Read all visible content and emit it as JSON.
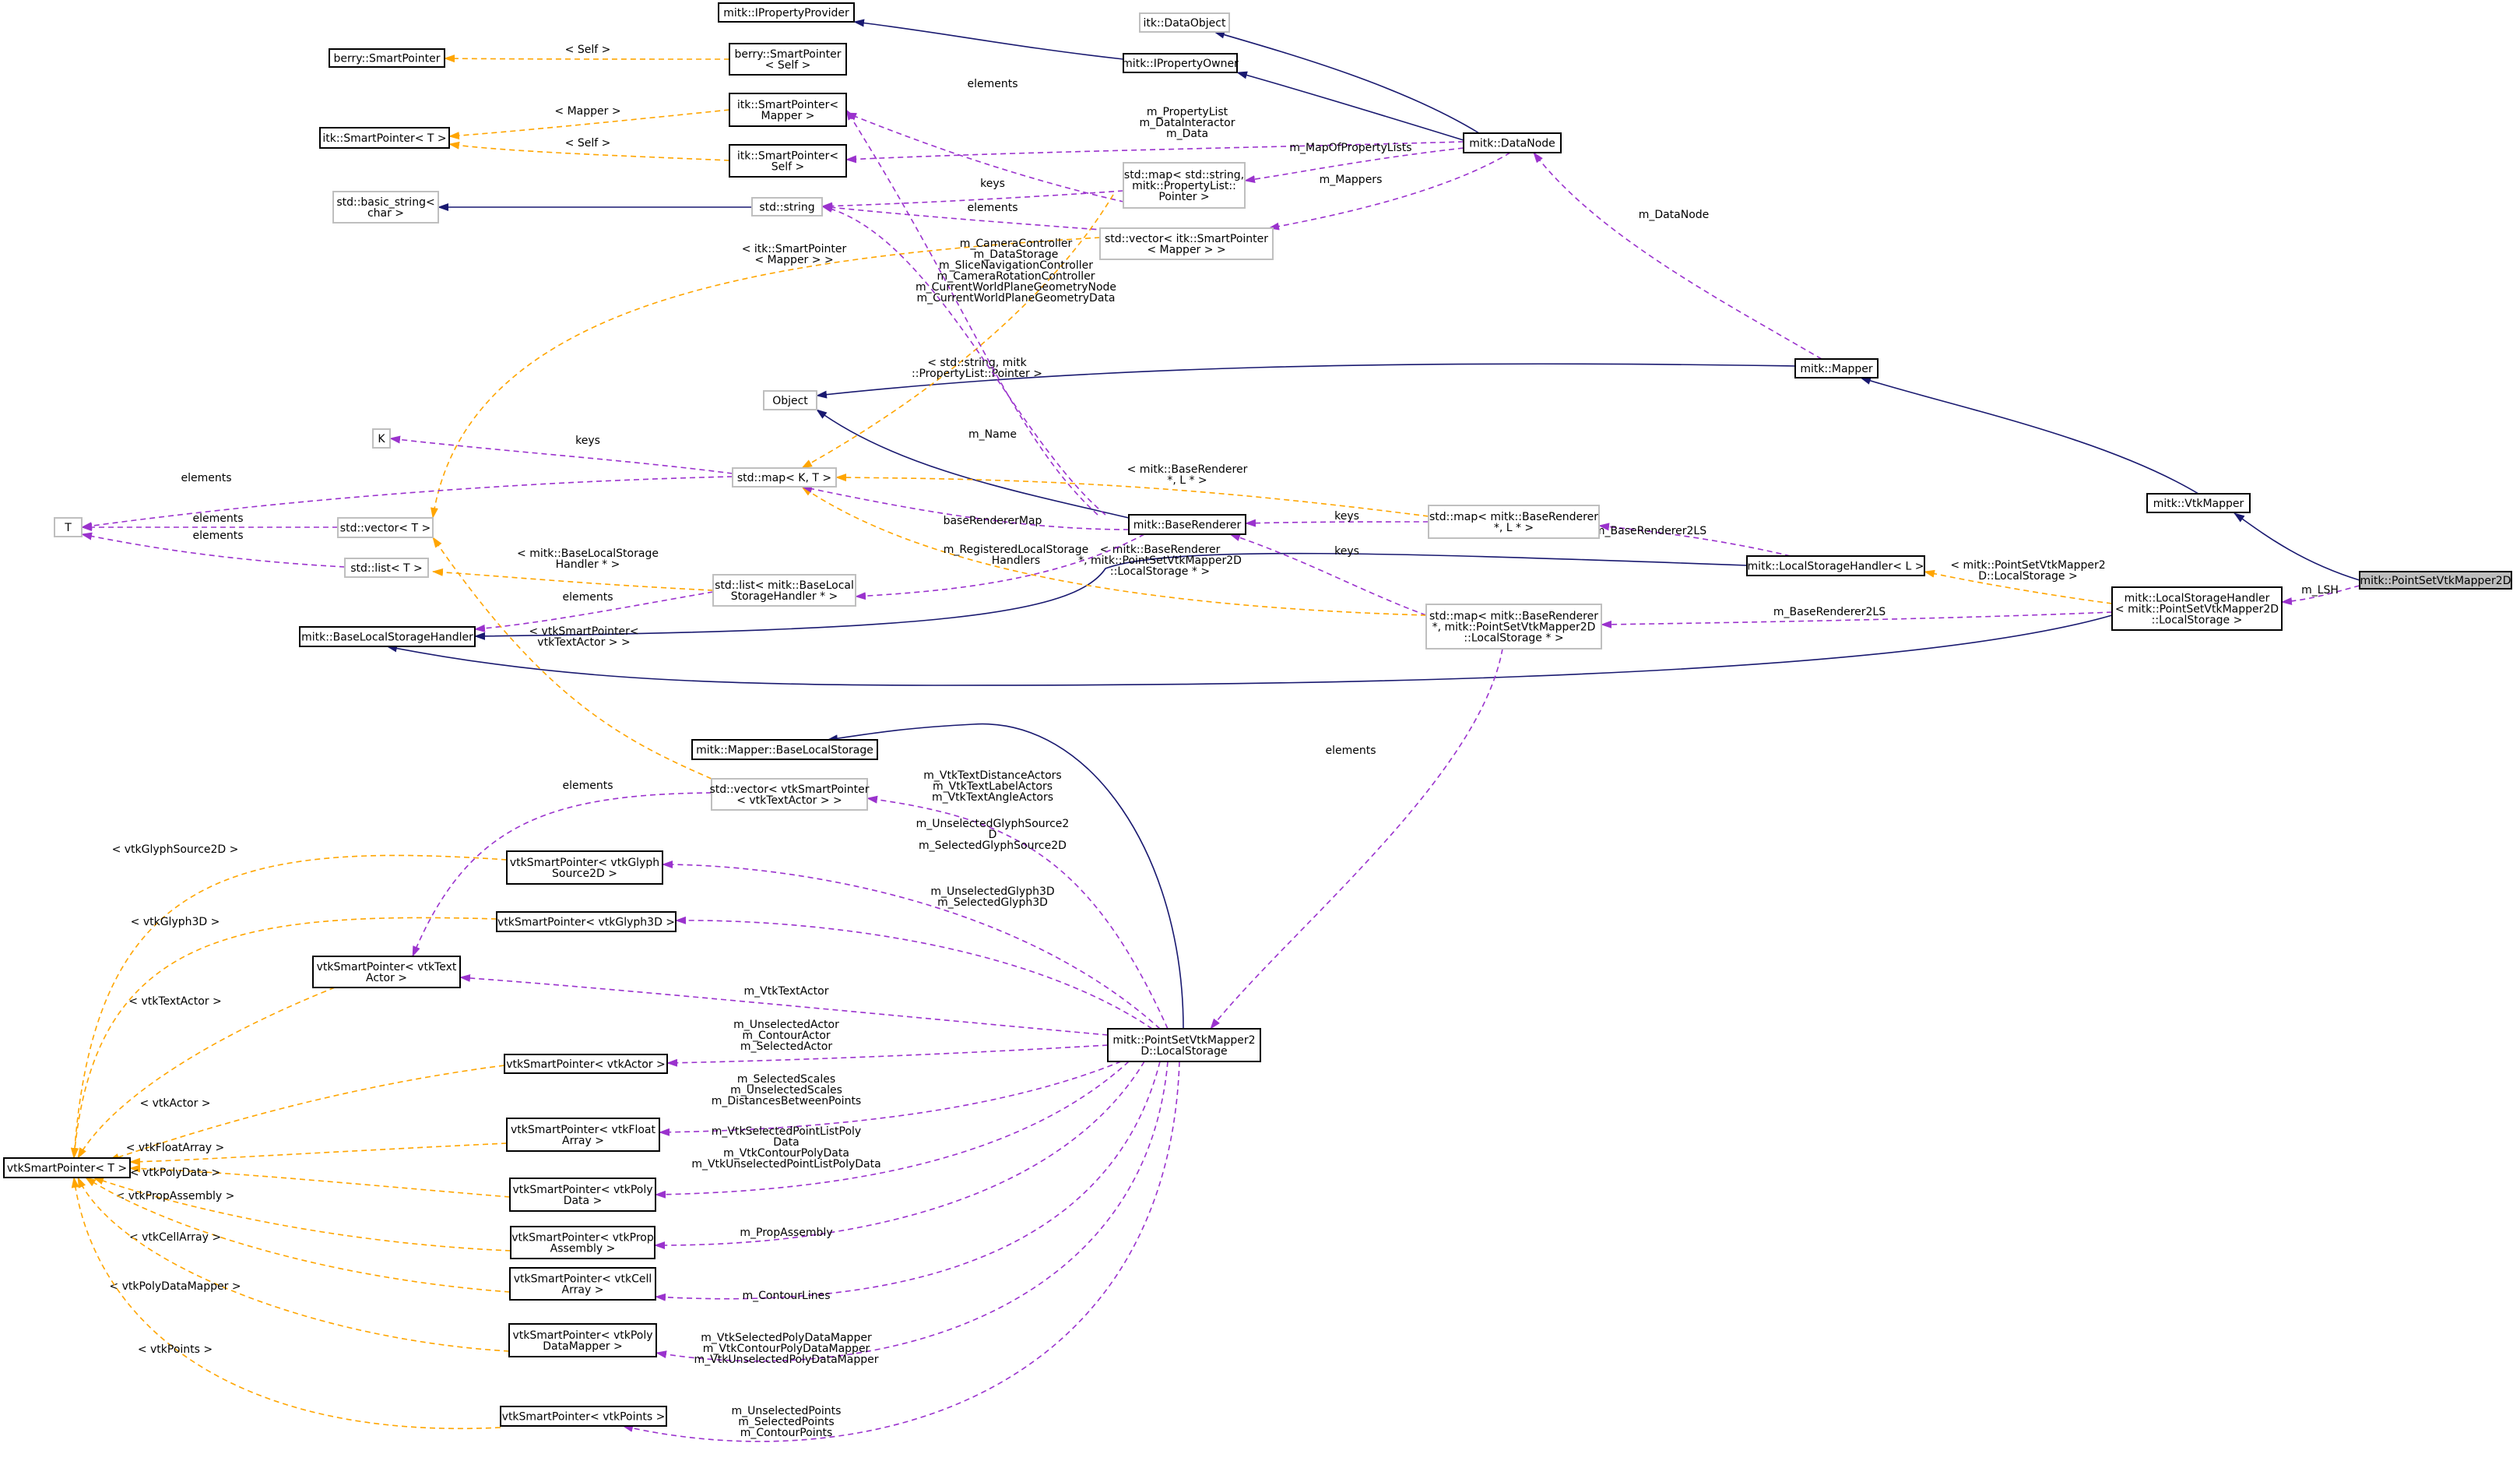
{
  "diagram": {
    "title": "",
    "colors": {
      "inheritance": "#191970",
      "usage": "#9A32CD",
      "template": "#FFA500",
      "node_border": "#000000",
      "node_border_dim": "#BFBFBF",
      "highlight_fill": "#BFBFBF",
      "background": "#FFFFFF"
    },
    "nodes": [
      {
        "id": "n1",
        "lines": [
          "mitk::PointSetVtkMapper2D"
        ],
        "style": "highlight"
      },
      {
        "id": "n2",
        "lines": [
          "mitk::VtkMapper"
        ],
        "style": "solid"
      },
      {
        "id": "n3",
        "lines": [
          "mitk::Mapper"
        ],
        "style": "solid"
      },
      {
        "id": "n4",
        "lines": [
          "Object"
        ],
        "style": "dim"
      },
      {
        "id": "n5",
        "lines": [
          "mitk::DataNode"
        ],
        "style": "solid"
      },
      {
        "id": "n6",
        "lines": [
          "mitk::IPropertyOwner"
        ],
        "style": "solid"
      },
      {
        "id": "n7",
        "lines": [
          "mitk::IPropertyProvider"
        ],
        "style": "solid"
      },
      {
        "id": "n8",
        "lines": [
          "itk::DataObject"
        ],
        "style": "dim"
      },
      {
        "id": "n9",
        "lines": [
          "berry::SmartPointer"
        ],
        "style": "solid"
      },
      {
        "id": "n10",
        "lines": [
          "berry::SmartPointer",
          "< Self >"
        ],
        "style": "solid"
      },
      {
        "id": "n11",
        "lines": [
          "itk::SmartPointer< T >"
        ],
        "style": "solid"
      },
      {
        "id": "n12",
        "lines": [
          "itk::SmartPointer<",
          "Mapper >"
        ],
        "style": "solid"
      },
      {
        "id": "n13",
        "lines": [
          "itk::SmartPointer<",
          "Self >"
        ],
        "style": "solid"
      },
      {
        "id": "n14",
        "lines": [
          "std::map< std::string,",
          "mitk::PropertyList::",
          "Pointer >"
        ],
        "style": "dim"
      },
      {
        "id": "n15",
        "lines": [
          "std::vector< itk::SmartPointer",
          "< Mapper > >"
        ],
        "style": "dim"
      },
      {
        "id": "n16",
        "lines": [
          "std::basic_string<",
          "char >"
        ],
        "style": "dim"
      },
      {
        "id": "n17",
        "lines": [
          "std::string"
        ],
        "style": "dim"
      },
      {
        "id": "n18",
        "lines": [
          "K"
        ],
        "style": "dim"
      },
      {
        "id": "n19",
        "lines": [
          "std::map< K, T >"
        ],
        "style": "dim"
      },
      {
        "id": "n20",
        "lines": [
          "T"
        ],
        "style": "dim"
      },
      {
        "id": "n21",
        "lines": [
          "std::vector< T >"
        ],
        "style": "dim"
      },
      {
        "id": "n22",
        "lines": [
          "std::list< T >"
        ],
        "style": "dim"
      },
      {
        "id": "n23",
        "lines": [
          "std::list< mitk::BaseLocal",
          "StorageHandler * >"
        ],
        "style": "dim"
      },
      {
        "id": "n24",
        "lines": [
          "mitk::BaseLocalStorageHandler"
        ],
        "style": "solid"
      },
      {
        "id": "n25",
        "lines": [
          "mitk::BaseRenderer"
        ],
        "style": "solid"
      },
      {
        "id": "n26",
        "lines": [
          "std::map< mitk::BaseRenderer",
          "*, L * >"
        ],
        "style": "dim"
      },
      {
        "id": "n27",
        "lines": [
          "mitk::LocalStorageHandler< L >"
        ],
        "style": "solid"
      },
      {
        "id": "n28",
        "lines": [
          "std::map< mitk::BaseRenderer",
          "*, mitk::PointSetVtkMapper2D",
          "::LocalStorage * >"
        ],
        "style": "dim"
      },
      {
        "id": "n29",
        "lines": [
          "mitk::LocalStorageHandler",
          "< mitk::PointSetVtkMapper2D",
          "::LocalStorage >"
        ],
        "style": "solid"
      },
      {
        "id": "n30",
        "lines": [
          "mitk::Mapper::BaseLocalStorage"
        ],
        "style": "solid"
      },
      {
        "id": "n31",
        "lines": [
          "std::vector< vtkSmartPointer",
          "< vtkTextActor > >"
        ],
        "style": "dim"
      },
      {
        "id": "n32",
        "lines": [
          "vtkSmartPointer< vtkGlyph",
          "Source2D >"
        ],
        "style": "solid"
      },
      {
        "id": "n33",
        "lines": [
          "vtkSmartPointer< vtkGlyph3D >"
        ],
        "style": "solid"
      },
      {
        "id": "n34",
        "lines": [
          "vtkSmartPointer< vtkText",
          "Actor >"
        ],
        "style": "solid"
      },
      {
        "id": "n35",
        "lines": [
          "vtkSmartPointer< vtkActor >"
        ],
        "style": "solid"
      },
      {
        "id": "n36",
        "lines": [
          "vtkSmartPointer< vtkFloat",
          "Array >"
        ],
        "style": "solid"
      },
      {
        "id": "n37",
        "lines": [
          "vtkSmartPointer< vtkPoly",
          "Data >"
        ],
        "style": "solid"
      },
      {
        "id": "n38",
        "lines": [
          "vtkSmartPointer< vtkProp",
          "Assembly >"
        ],
        "style": "solid"
      },
      {
        "id": "n39",
        "lines": [
          "vtkSmartPointer< vtkCell",
          "Array >"
        ],
        "style": "solid"
      },
      {
        "id": "n40",
        "lines": [
          "vtkSmartPointer< vtkPoly",
          "DataMapper >"
        ],
        "style": "solid"
      },
      {
        "id": "n41",
        "lines": [
          "vtkSmartPointer< vtkPoints >"
        ],
        "style": "solid"
      },
      {
        "id": "n42",
        "lines": [
          "vtkSmartPointer< T >"
        ],
        "style": "solid"
      },
      {
        "id": "n43",
        "lines": [
          "mitk::PointSetVtkMapper2",
          "D::LocalStorage"
        ],
        "style": "solid"
      }
    ],
    "edges": [
      {
        "id": "e1",
        "kind": "inheritance",
        "label": []
      },
      {
        "id": "e2",
        "kind": "inheritance",
        "label": []
      },
      {
        "id": "e3",
        "kind": "inheritance",
        "label": []
      },
      {
        "id": "e4",
        "kind": "inheritance",
        "label": []
      },
      {
        "id": "e5",
        "kind": "inheritance",
        "label": []
      },
      {
        "id": "e6",
        "kind": "inheritance",
        "label": []
      },
      {
        "id": "e7",
        "kind": "inheritance",
        "label": []
      },
      {
        "id": "e8",
        "kind": "inheritance",
        "label": []
      },
      {
        "id": "e9",
        "kind": "inheritance",
        "label": []
      },
      {
        "id": "e10",
        "kind": "inheritance",
        "label": []
      },
      {
        "id": "e11",
        "kind": "inheritance",
        "label": []
      },
      {
        "id": "e12",
        "kind": "inheritance",
        "label": []
      },
      {
        "id": "e13",
        "kind": "usage",
        "label": [
          "m_LSH"
        ]
      },
      {
        "id": "e14",
        "kind": "template",
        "label": [
          "< mitk::PointSetVtkMapper2",
          "D::LocalStorage >"
        ]
      },
      {
        "id": "e15",
        "kind": "usage",
        "label": [
          "m_BaseRenderer2LS"
        ]
      },
      {
        "id": "e16",
        "kind": "usage",
        "label": [
          "m_BaseRenderer2LS"
        ]
      },
      {
        "id": "e17",
        "kind": "usage",
        "label": [
          "keys"
        ]
      },
      {
        "id": "e18",
        "kind": "template",
        "label": [
          "< mitk::BaseRenderer",
          "*, L * >"
        ]
      },
      {
        "id": "e19",
        "kind": "usage",
        "label": [
          "keys"
        ]
      },
      {
        "id": "e20",
        "kind": "template",
        "label": [
          "< mitk::BaseRenderer",
          "*, mitk::PointSetVtkMapper2D",
          "::LocalStorage * >"
        ]
      },
      {
        "id": "e21",
        "kind": "usage",
        "label": [
          "elements"
        ]
      },
      {
        "id": "e22",
        "kind": "usage",
        "label": [
          "m_DataNode"
        ]
      },
      {
        "id": "e23",
        "kind": "usage",
        "label": [
          "m_PropertyList",
          "m_DataInteractor",
          "m_Data"
        ]
      },
      {
        "id": "e24",
        "kind": "usage",
        "label": [
          "m_MapOfPropertyLists"
        ]
      },
      {
        "id": "e25",
        "kind": "usage",
        "label": [
          "m_Mappers"
        ]
      },
      {
        "id": "e26",
        "kind": "usage",
        "label": [
          "elements"
        ]
      },
      {
        "id": "e27",
        "kind": "template",
        "label": [
          "< std::string, mitk",
          "::PropertyList::Pointer >"
        ]
      },
      {
        "id": "e28",
        "kind": "usage",
        "label": [
          "keys"
        ]
      },
      {
        "id": "e29",
        "kind": "usage",
        "label": [
          "elements"
        ]
      },
      {
        "id": "e30",
        "kind": "template",
        "label": [
          "< itk::SmartPointer",
          "< Mapper > >"
        ]
      },
      {
        "id": "e31",
        "kind": "template",
        "label": [
          "< Self >"
        ]
      },
      {
        "id": "e32",
        "kind": "template",
        "label": [
          "< Mapper >"
        ]
      },
      {
        "id": "e33",
        "kind": "template",
        "label": [
          "< Self >"
        ]
      },
      {
        "id": "e34",
        "kind": "usage",
        "label": [
          "m_CameraController",
          "m_DataStorage",
          "m_SliceNavigationController",
          "m_CameraRotationController",
          "m_CurrentWorldPlaneGeometryNode",
          "m_CurrentWorldPlaneGeometryData"
        ]
      },
      {
        "id": "e35",
        "kind": "usage",
        "label": [
          "m_Name"
        ]
      },
      {
        "id": "e36",
        "kind": "usage",
        "label": [
          "baseRendererMap"
        ]
      },
      {
        "id": "e37",
        "kind": "template",
        "label": [
          "< mitk::BaseRenderer",
          "*, L * >"
        ]
      },
      {
        "id": "e38",
        "kind": "usage",
        "label": [
          "keys"
        ]
      },
      {
        "id": "e39",
        "kind": "usage",
        "label": [
          "elements"
        ]
      },
      {
        "id": "e40",
        "kind": "usage",
        "label": [
          "elements"
        ]
      },
      {
        "id": "e41",
        "kind": "usage",
        "label": [
          "elements"
        ]
      },
      {
        "id": "e42",
        "kind": "usage",
        "label": [
          "m_RegisteredLocalStorage",
          "Handlers"
        ]
      },
      {
        "id": "e43",
        "kind": "template",
        "label": [
          "< mitk::BaseLocalStorage",
          "Handler * >"
        ]
      },
      {
        "id": "e44",
        "kind": "usage",
        "label": [
          "elements"
        ]
      },
      {
        "id": "e45",
        "kind": "template",
        "label": [
          "< vtkSmartPointer<",
          "vtkTextActor > >"
        ]
      },
      {
        "id": "e46",
        "kind": "usage",
        "label": [
          "elements"
        ]
      },
      {
        "id": "e47",
        "kind": "usage",
        "label": [
          "m_VtkTextDistanceActors",
          "m_VtkTextLabelActors",
          "m_VtkTextAngleActors"
        ]
      },
      {
        "id": "e48",
        "kind": "usage",
        "label": [
          "m_UnselectedGlyphSource2",
          "D",
          "m_SelectedGlyphSource2D"
        ]
      },
      {
        "id": "e49",
        "kind": "usage",
        "label": [
          "m_UnselectedGlyph3D",
          "m_SelectedGlyph3D"
        ]
      },
      {
        "id": "e50",
        "kind": "usage",
        "label": [
          "m_VtkTextActor"
        ]
      },
      {
        "id": "e51",
        "kind": "usage",
        "label": [
          "m_UnselectedActor",
          "m_ContourActor",
          "m_SelectedActor"
        ]
      },
      {
        "id": "e52",
        "kind": "usage",
        "label": [
          "m_SelectedScales",
          "m_UnselectedScales",
          "m_DistancesBetweenPoints"
        ]
      },
      {
        "id": "e53",
        "kind": "usage",
        "label": [
          "m_VtkSelectedPointListPoly",
          "Data",
          "m_VtkContourPolyData",
          "m_VtkUnselectedPointListPolyData"
        ]
      },
      {
        "id": "e54",
        "kind": "usage",
        "label": [
          "m_PropAssembly"
        ]
      },
      {
        "id": "e55",
        "kind": "usage",
        "label": [
          "m_ContourLines"
        ]
      },
      {
        "id": "e56",
        "kind": "usage",
        "label": [
          "m_VtkSelectedPolyDataMapper",
          "m_VtkContourPolyDataMapper",
          "m_VtkUnselectedPolyDataMapper"
        ]
      },
      {
        "id": "e57",
        "kind": "usage",
        "label": [
          "m_UnselectedPoints",
          "m_SelectedPoints",
          "m_ContourPoints"
        ]
      },
      {
        "id": "e58",
        "kind": "template",
        "label": [
          "< vtkGlyphSource2D >"
        ]
      },
      {
        "id": "e59",
        "kind": "template",
        "label": [
          "< vtkGlyph3D >"
        ]
      },
      {
        "id": "e60",
        "kind": "template",
        "label": [
          "< vtkTextActor >"
        ]
      },
      {
        "id": "e61",
        "kind": "template",
        "label": [
          "< vtkActor >"
        ]
      },
      {
        "id": "e62",
        "kind": "template",
        "label": [
          "< vtkFloatArray >"
        ]
      },
      {
        "id": "e63",
        "kind": "template",
        "label": [
          "< vtkPolyData >"
        ]
      },
      {
        "id": "e64",
        "kind": "template",
        "label": [
          "< vtkPropAssembly >"
        ]
      },
      {
        "id": "e65",
        "kind": "template",
        "label": [
          "< vtkCellArray >"
        ]
      },
      {
        "id": "e66",
        "kind": "template",
        "label": [
          "< vtkPolyDataMapper >"
        ]
      },
      {
        "id": "e67",
        "kind": "template",
        "label": [
          "< vtkPoints >"
        ]
      }
    ]
  }
}
